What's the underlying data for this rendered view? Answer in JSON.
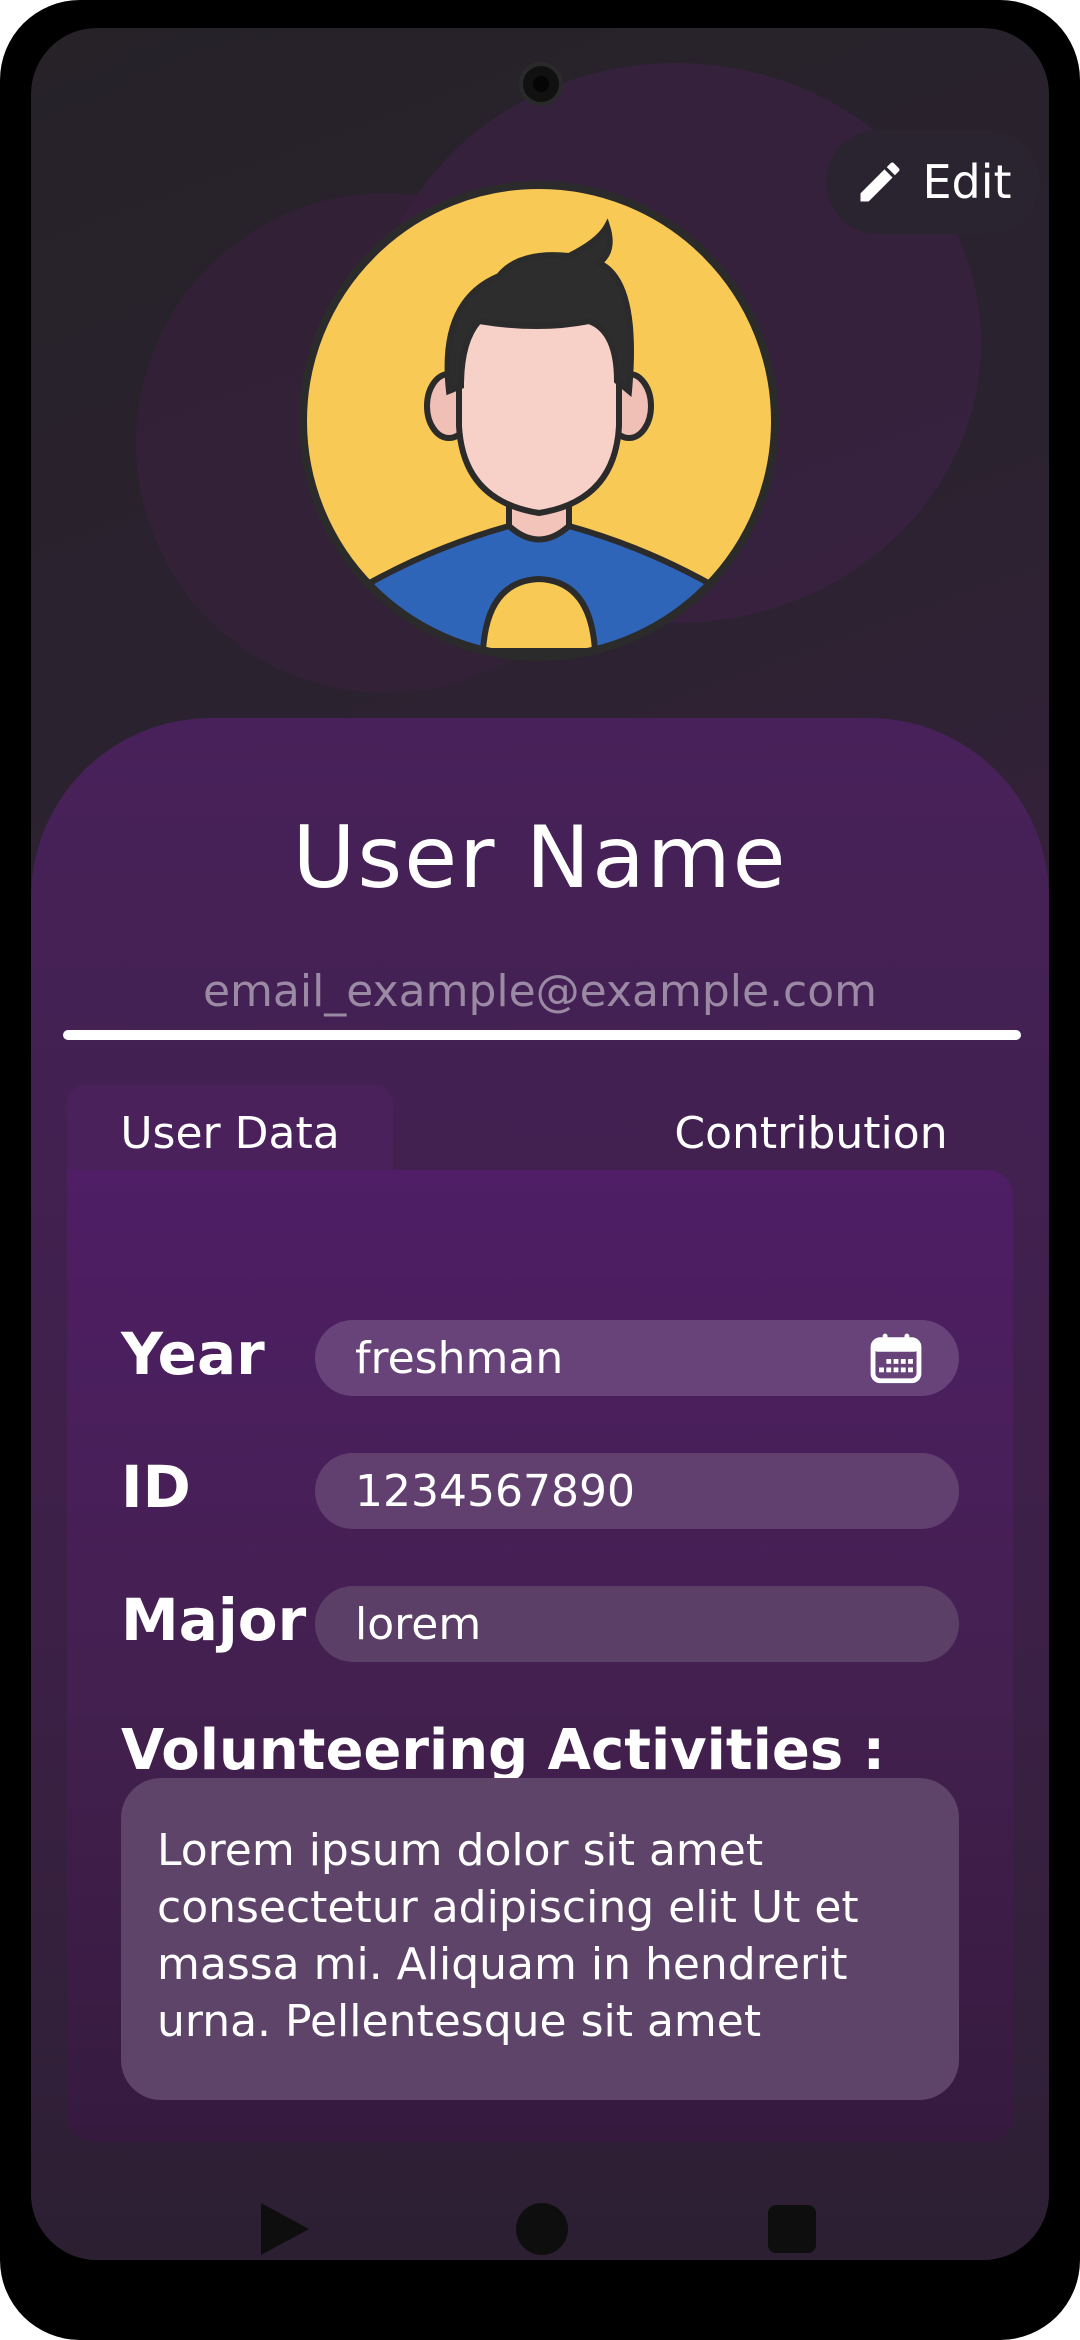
{
  "profile": {
    "edit_label": "Edit",
    "user_name": "User Name",
    "email": "email_example@example.com"
  },
  "tabs": [
    {
      "label": "User Data",
      "active": true
    },
    {
      "label": "Contribution",
      "active": false
    }
  ],
  "fields": {
    "year_label": "Year",
    "year_value": "freshman",
    "id_label": "ID",
    "id_value": "1234567890",
    "major_label": "Major",
    "major_value": "lorem"
  },
  "volunteering": {
    "title": "Volunteering Activities :",
    "text": "Lorem ipsum dolor sit amet consectetur adipiscing elit Ut et massa mi. Aliquam in hendrerit urna. Pellentesque sit amet"
  },
  "icons": [
    "pencil-icon",
    "calendar-icon",
    "avatar-illustration",
    "nav-back-icon",
    "nav-home-icon",
    "nav-recent-icon"
  ],
  "colors": {
    "accent_purple": "#4b215c",
    "field_bg": "#67437a",
    "avatar_bg": "#f9c956"
  }
}
